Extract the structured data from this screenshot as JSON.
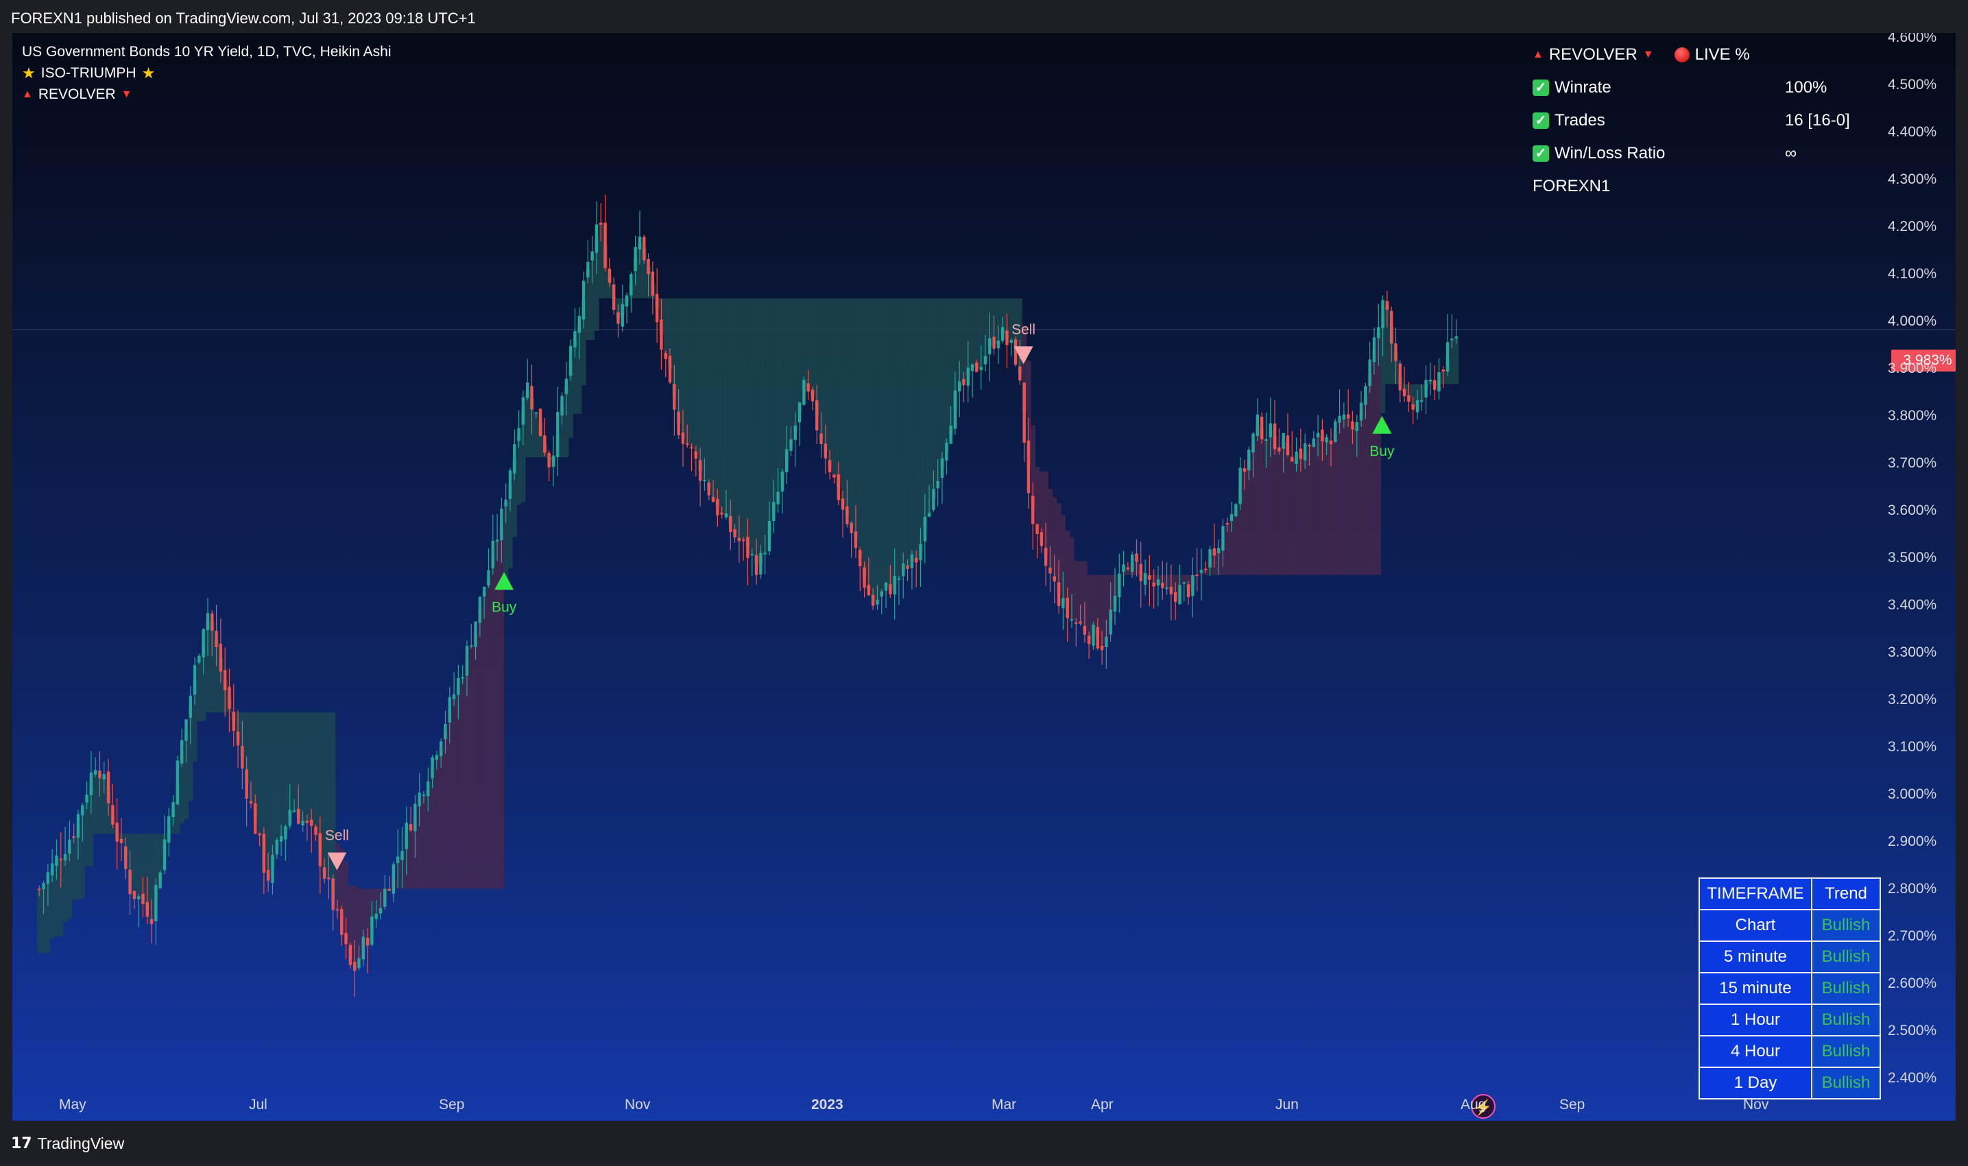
{
  "header": {
    "published": "FOREXN1 published on TradingView.com, Jul 31, 2023 09:18 UTC+1"
  },
  "legend": {
    "title": "US Government Bonds 10 YR Yield, 1D, TVC, Heikin Ashi",
    "indicator1": "ISO-TRIUMPH",
    "indicator2": "REVOLVER"
  },
  "stats_panel": {
    "heading": "REVOLVER",
    "live": "LIVE %",
    "rows": [
      {
        "label": "Winrate",
        "value": "100%"
      },
      {
        "label": "Trades",
        "value": "16 [16-0]"
      },
      {
        "label": "Win/Loss Ratio",
        "value": "∞"
      }
    ],
    "author": "FOREXN1"
  },
  "current_price": "3.983%",
  "signals": {
    "buy": "Buy",
    "sell": "Sell"
  },
  "timeframe_table": {
    "header": [
      "TIMEFRAME",
      "Trend"
    ],
    "rows": [
      {
        "tf": "Chart",
        "trend": "Bullish"
      },
      {
        "tf": "5 minute",
        "trend": "Bullish"
      },
      {
        "tf": "15 minute",
        "trend": "Bullish"
      },
      {
        "tf": "1 Hour",
        "trend": "Bullish"
      },
      {
        "tf": "4 Hour",
        "trend": "Bullish"
      },
      {
        "tf": "1 Day",
        "trend": "Bullish"
      }
    ]
  },
  "branding": {
    "name": "TradingView",
    "mark": "17"
  },
  "colors": {
    "bull_candle": "#26a69a",
    "bear_candle": "#ef5350",
    "bull_band": "#1d4a4f",
    "bear_band": "#4a2a4c",
    "buy_signal": "#2ee84a",
    "sell_signal": "#f4a6aa"
  },
  "chart_data": {
    "type": "candlestick",
    "title": "US Government Bonds 10 YR Yield, 1D, TVC, Heikin Ashi",
    "x_ticks": [
      "May",
      "Jul",
      "Sep",
      "Nov",
      "2023",
      "Mar",
      "Apr",
      "Jun",
      "Aug",
      "Sep",
      "Nov"
    ],
    "y_ticks": [
      "4.600%",
      "4.500%",
      "4.400%",
      "4.300%",
      "4.200%",
      "4.100%",
      "4.000%",
      "3.900%",
      "3.800%",
      "3.700%",
      "3.600%",
      "3.500%",
      "3.400%",
      "3.300%",
      "3.200%",
      "3.100%",
      "3.000%",
      "2.900%",
      "2.800%",
      "2.700%",
      "2.600%",
      "2.500%",
      "2.400%"
    ],
    "ylim": [
      2.37,
      4.62
    ],
    "last_value": 3.983,
    "price_path": [
      {
        "date": "2022-04-20",
        "value": 2.8
      },
      {
        "date": "2022-05-01",
        "value": 2.92
      },
      {
        "date": "2022-05-09",
        "value": 3.08
      },
      {
        "date": "2022-05-20",
        "value": 2.8
      },
      {
        "date": "2022-05-27",
        "value": 2.75
      },
      {
        "date": "2022-06-14",
        "value": 3.4
      },
      {
        "date": "2022-06-26",
        "value": 3.05
      },
      {
        "date": "2022-07-04",
        "value": 2.82
      },
      {
        "date": "2022-07-12",
        "value": 2.98
      },
      {
        "date": "2022-07-20",
        "value": 2.9
      },
      {
        "date": "2022-08-01",
        "value": 2.62
      },
      {
        "date": "2022-08-12",
        "value": 2.8
      },
      {
        "date": "2022-08-26",
        "value": 3.05
      },
      {
        "date": "2022-09-07",
        "value": 3.28
      },
      {
        "date": "2022-09-19",
        "value": 3.58
      },
      {
        "date": "2022-09-27",
        "value": 3.88
      },
      {
        "date": "2022-10-05",
        "value": 3.7
      },
      {
        "date": "2022-10-21",
        "value": 4.22
      },
      {
        "date": "2022-10-27",
        "value": 4.0
      },
      {
        "date": "2022-11-04",
        "value": 4.18
      },
      {
        "date": "2022-11-15",
        "value": 3.8
      },
      {
        "date": "2022-12-01",
        "value": 3.58
      },
      {
        "date": "2022-12-13",
        "value": 3.48
      },
      {
        "date": "2022-12-28",
        "value": 3.86
      },
      {
        "date": "2023-01-05",
        "value": 3.7
      },
      {
        "date": "2023-01-19",
        "value": 3.4
      },
      {
        "date": "2023-02-03",
        "value": 3.5
      },
      {
        "date": "2023-02-15",
        "value": 3.83
      },
      {
        "date": "2023-03-02",
        "value": 3.98
      },
      {
        "date": "2023-03-08",
        "value": 3.92
      },
      {
        "date": "2023-03-13",
        "value": 3.55
      },
      {
        "date": "2023-03-24",
        "value": 3.38
      },
      {
        "date": "2023-04-05",
        "value": 3.32
      },
      {
        "date": "2023-04-13",
        "value": 3.5
      },
      {
        "date": "2023-04-25",
        "value": 3.42
      },
      {
        "date": "2023-05-05",
        "value": 3.44
      },
      {
        "date": "2023-05-16",
        "value": 3.58
      },
      {
        "date": "2023-05-26",
        "value": 3.78
      },
      {
        "date": "2023-06-08",
        "value": 3.72
      },
      {
        "date": "2023-06-28",
        "value": 3.8
      },
      {
        "date": "2023-07-07",
        "value": 4.05
      },
      {
        "date": "2023-07-14",
        "value": 3.8
      },
      {
        "date": "2023-07-24",
        "value": 3.88
      },
      {
        "date": "2023-07-31",
        "value": 3.983
      }
    ],
    "signals": [
      {
        "type": "Sell",
        "date": "2022-07-27",
        "value": 2.86
      },
      {
        "type": "Buy",
        "date": "2022-09-20",
        "value": 3.45
      },
      {
        "type": "Sell",
        "date": "2023-03-10",
        "value": 3.93
      },
      {
        "type": "Buy",
        "date": "2023-07-06",
        "value": 3.78
      }
    ]
  }
}
